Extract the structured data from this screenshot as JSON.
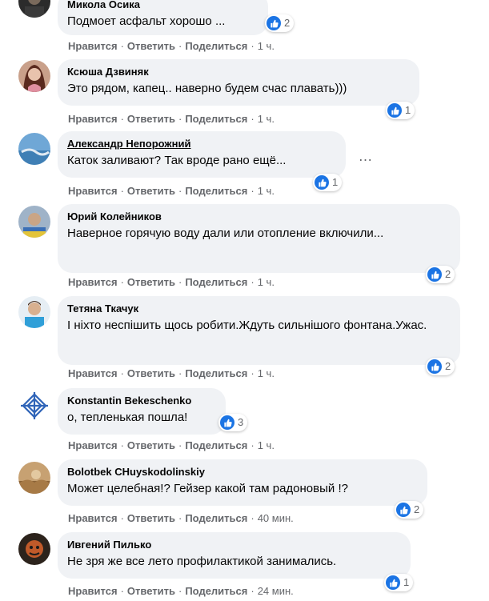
{
  "ui": {
    "like_color": "#1b74e4",
    "bubble_color": "#f0f2f5",
    "meta_color": "#65676b"
  },
  "actions": {
    "like": "Нравится",
    "reply": "Ответить",
    "share": "Поделиться",
    "separator": "·"
  },
  "more_icon": "…",
  "comments": [
    {
      "author": "Микола Осика",
      "text": "Подмоет асфальт хорошо ...",
      "likes": "2",
      "time": "1 ч."
    },
    {
      "author": "Ксюша Дзвиняк",
      "text": "Это рядом, капец.. наверно будем счас плавать)))",
      "likes": "1",
      "time": "1 ч."
    },
    {
      "author": "Александр Непорожний",
      "text": "Каток заливают? Так вроде рано ещё...",
      "likes": "1",
      "time": "1 ч."
    },
    {
      "author": "Юрий Колейников",
      "text": "Наверное горячую воду дали или отопление включили...",
      "likes": "2",
      "time": "1 ч."
    },
    {
      "author": "Тетяна Ткачук",
      "text": "І ніхто неспішить щось робити.Ждуть сильнішого фонтана.Ужас.",
      "likes": "2",
      "time": "1 ч."
    },
    {
      "author": "Konstantin Bekeschenko",
      "text": "о, тепленькая пошла!",
      "likes": "3",
      "time": "1 ч."
    },
    {
      "author": "Bolotbek CHuyskodolinskiy",
      "text": "Может целебная!? Гейзер какой там радоновый !?",
      "likes": "2",
      "time": "40 мин."
    },
    {
      "author": "Ивгений Пилько",
      "text": "Не зря же все лето профилактикой занимались.",
      "likes": "1",
      "time": "24 мин."
    }
  ]
}
